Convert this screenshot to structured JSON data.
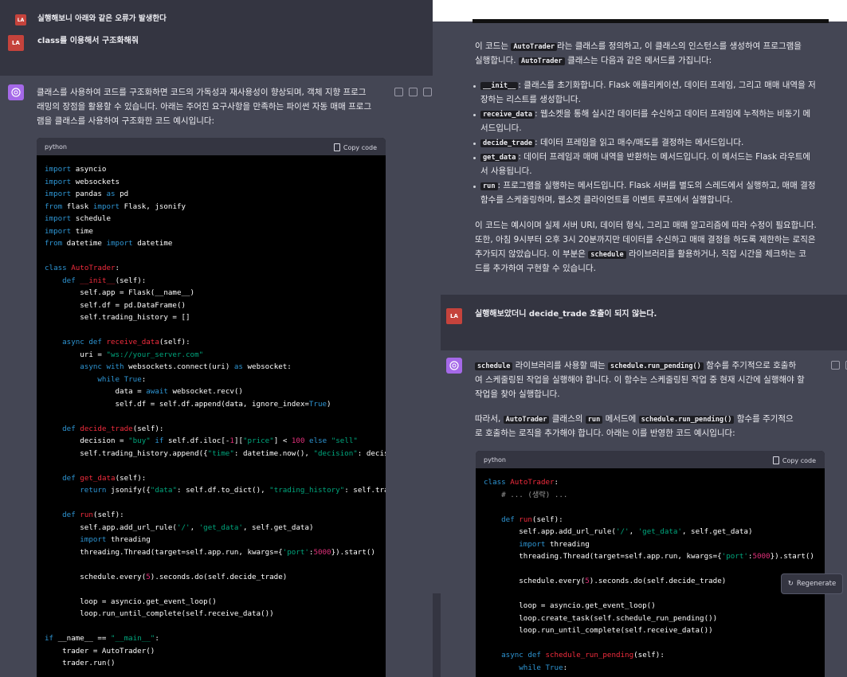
{
  "left": {
    "user_msg_1": "실행해보니 아래와 같은 오류가 발생한다",
    "user_msg_2": "class를 이용해서 구조화해줘",
    "user_avatar": "LA",
    "answer_line_1": "클래스를 사용하여 코드를 구조화하면 코드의 가독성과 재사용성이 향상되며, 객체 지향 프로그",
    "answer_line_2": "래밍의 장점을 활용할 수 있습니다. 아래는 주어진 요구사항을 만족하는 파이썬 자동 매매 프로그",
    "answer_line_3": "램을 클래스를 사용하여 구조화한 코드 예시입니다:",
    "code_lang": "python",
    "copy_label": "Copy code",
    "code": [
      [
        [
          "k",
          "import"
        ],
        [
          "t",
          " asyncio"
        ]
      ],
      [
        [
          "k",
          "import"
        ],
        [
          "t",
          " websockets"
        ]
      ],
      [
        [
          "k",
          "import"
        ],
        [
          "t",
          " pandas "
        ],
        [
          "k",
          "as"
        ],
        [
          "t",
          " pd"
        ]
      ],
      [
        [
          "k",
          "from"
        ],
        [
          "t",
          " flask "
        ],
        [
          "k",
          "import"
        ],
        [
          "t",
          " Flask, jsonify"
        ]
      ],
      [
        [
          "k",
          "import"
        ],
        [
          "t",
          " schedule"
        ]
      ],
      [
        [
          "k",
          "import"
        ],
        [
          "t",
          " time"
        ]
      ],
      [
        [
          "k",
          "from"
        ],
        [
          "t",
          " datetime "
        ],
        [
          "k",
          "import"
        ],
        [
          "t",
          " datetime"
        ]
      ],
      [],
      [
        [
          "k",
          "class"
        ],
        [
          "t",
          " "
        ],
        [
          "c",
          "AutoTrader"
        ],
        [
          "t",
          ":"
        ]
      ],
      [
        [
          "t",
          "    "
        ],
        [
          "k",
          "def"
        ],
        [
          "t",
          " "
        ],
        [
          "c",
          "__init__"
        ],
        [
          "t",
          "(self):"
        ]
      ],
      [
        [
          "t",
          "        self.app = Flask(__name__)"
        ]
      ],
      [
        [
          "t",
          "        self.df = pd.DataFrame()"
        ]
      ],
      [
        [
          "t",
          "        self.trading_history = []"
        ]
      ],
      [],
      [
        [
          "t",
          "    "
        ],
        [
          "k",
          "async def"
        ],
        [
          "t",
          " "
        ],
        [
          "c",
          "receive_data"
        ],
        [
          "t",
          "(self):"
        ]
      ],
      [
        [
          "t",
          "        uri = "
        ],
        [
          "s",
          "\"ws://your_server.com\""
        ]
      ],
      [
        [
          "t",
          "        "
        ],
        [
          "k",
          "async with"
        ],
        [
          "t",
          " websockets.connect(uri) "
        ],
        [
          "k",
          "as"
        ],
        [
          "t",
          " websocket:"
        ]
      ],
      [
        [
          "t",
          "            "
        ],
        [
          "k",
          "while"
        ],
        [
          "t",
          " "
        ],
        [
          "k",
          "True"
        ],
        [
          "t",
          ":"
        ]
      ],
      [
        [
          "t",
          "                data = "
        ],
        [
          "k",
          "await"
        ],
        [
          "t",
          " websocket.recv()"
        ]
      ],
      [
        [
          "t",
          "                self.df = self.df.append(data, ignore_index="
        ],
        [
          "k",
          "True"
        ],
        [
          "t",
          ")"
        ]
      ],
      [],
      [
        [
          "t",
          "    "
        ],
        [
          "k",
          "def"
        ],
        [
          "t",
          " "
        ],
        [
          "c",
          "decide_trade"
        ],
        [
          "t",
          "(self):"
        ]
      ],
      [
        [
          "t",
          "        decision = "
        ],
        [
          "s",
          "\"buy\""
        ],
        [
          "t",
          " "
        ],
        [
          "k",
          "if"
        ],
        [
          "t",
          " self.df.iloc[-"
        ],
        [
          "n",
          "1"
        ],
        [
          "t",
          "]["
        ],
        [
          "s",
          "\"price\""
        ],
        [
          "t",
          "] < "
        ],
        [
          "n",
          "100"
        ],
        [
          "t",
          " "
        ],
        [
          "k",
          "else"
        ],
        [
          "t",
          " "
        ],
        [
          "s",
          "\"sell\""
        ]
      ],
      [
        [
          "t",
          "        self.trading_history.append({"
        ],
        [
          "s",
          "\"time\""
        ],
        [
          "t",
          ": datetime.now(), "
        ],
        [
          "s",
          "\"decision\""
        ],
        [
          "t",
          ": decision})"
        ]
      ],
      [],
      [
        [
          "t",
          "    "
        ],
        [
          "k",
          "def"
        ],
        [
          "t",
          " "
        ],
        [
          "c",
          "get_data"
        ],
        [
          "t",
          "(self):"
        ]
      ],
      [
        [
          "t",
          "        "
        ],
        [
          "k",
          "return"
        ],
        [
          "t",
          " jsonify({"
        ],
        [
          "s",
          "\"data\""
        ],
        [
          "t",
          ": self.df.to_dict(), "
        ],
        [
          "s",
          "\"trading_history\""
        ],
        [
          "t",
          ": self.trading_history})"
        ]
      ],
      [],
      [
        [
          "t",
          "    "
        ],
        [
          "k",
          "def"
        ],
        [
          "t",
          " "
        ],
        [
          "c",
          "run"
        ],
        [
          "t",
          "(self):"
        ]
      ],
      [
        [
          "t",
          "        self.app.add_url_rule("
        ],
        [
          "s",
          "'/'"
        ],
        [
          "t",
          ", "
        ],
        [
          "s",
          "'get_data'"
        ],
        [
          "t",
          ", self.get_data)"
        ]
      ],
      [
        [
          "t",
          "        "
        ],
        [
          "k",
          "import"
        ],
        [
          "t",
          " threading"
        ]
      ],
      [
        [
          "t",
          "        threading.Thread(target=self.app.run, kwargs={"
        ],
        [
          "s",
          "'port'"
        ],
        [
          "t",
          ":"
        ],
        [
          "n",
          "5000"
        ],
        [
          "t",
          "}).start()"
        ]
      ],
      [],
      [
        [
          "t",
          "        schedule.every("
        ],
        [
          "n",
          "5"
        ],
        [
          "t",
          ").seconds.do(self.decide_trade)"
        ]
      ],
      [],
      [
        [
          "t",
          "        loop = asyncio.get_event_loop()"
        ]
      ],
      [
        [
          "t",
          "        loop.run_until_complete(self.receive_data())"
        ]
      ],
      [],
      [
        [
          "k",
          "if"
        ],
        [
          "t",
          " __name__ == "
        ],
        [
          "s",
          "\"__main__\""
        ],
        [
          "t",
          ":"
        ]
      ],
      [
        [
          "t",
          "    trader = AutoTrader()"
        ]
      ],
      [
        [
          "t",
          "    trader.run()"
        ]
      ]
    ]
  },
  "right": {
    "intro_1_pre": "이 코드는 ",
    "intro_1_code": "AutoTrader",
    "intro_1_post": "라는 클래스를 정의하고, 이 클래스의 인스턴스를 생성하여 프로그램을",
    "intro_2_pre": "실행합니다. ",
    "intro_2_code": "AutoTrader",
    "intro_2_post": " 클래스는 다음과 같은 메서드를 가집니다:",
    "b1_code": "__init__",
    "b1_l1": ": 클래스를 초기화합니다. Flask 애플리케이션, 데이터 프레임, 그리고 매매 내역을 저",
    "b1_l2": "장하는 리스트를 생성합니다.",
    "b2_code": "receive_data",
    "b2_l1": ": 웹소켓을 통해 실시간 데이터를 수신하고 데이터 프레임에 누적하는 비동기 메",
    "b2_l2": "서드입니다.",
    "b3_code": "decide_trade",
    "b3_l1": ": 데이터 프레임을 읽고 매수/매도를 결정하는 메서드입니다.",
    "b4_code": "get_data",
    "b4_l1": ": 데이터 프레임과 매매 내역을 반환하는 메서드입니다. 이 메서드는 Flask 라우트에",
    "b4_l2": "서 사용됩니다.",
    "b5_code": "run",
    "b5_l1": ": 프로그램을 실행하는 메서드입니다. Flask 서버를 별도의 스레드에서 실행하고, 매매 결정",
    "b5_l2": "함수를 스케줄링하며, 웹소켓 클라이언트를 이벤트 루프에서 실행합니다.",
    "note_1": "이 코드는 예시이며 실제 서버 URI, 데이터 형식, 그리고 매매 알고리즘에 따라 수정이 필요합니다.",
    "note_2": "또한, 아침 9시부터 오후 3시 20분까지만 데이터를 수신하고 매매 결정을 하도록 제한하는 로직은",
    "note_3_pre": "추가되지 않았습니다. 이 부분은 ",
    "note_3_code": "schedule",
    "note_3_post": " 라이브러리를 활용하거나, 직접 시간을 체크하는 코",
    "note_4": "드를 추가하여 구현할 수 있습니다.",
    "user_avatar": "LA",
    "user_msg": "실행해보았더니 decide_trade 호출이 되지 않는다.",
    "ans_1_code": "schedule",
    "ans_1_mid": " 라이브러리를 사용할 때는 ",
    "ans_1_code2": "schedule.run_pending()",
    "ans_1_post": " 함수를 주기적으로 호출하",
    "ans_2": "여 스케줄링된 작업을 실행해야 합니다. 이 함수는 스케줄링된 작업 중 현재 시간에 실행해야 할",
    "ans_3": "작업을 찾아 실행합니다.",
    "ans_4_pre": "따라서, ",
    "ans_4_code": "AutoTrader",
    "ans_4_mid": " 클래스의 ",
    "ans_4_code2": "run",
    "ans_4_mid2": " 메서드에 ",
    "ans_4_code3": "schedule.run_pending()",
    "ans_4_post": " 함수를 주기적으",
    "ans_5": "로 호출하는 로직을 추가해야 합니다. 아래는 이를 반영한 코드 예시입니다:",
    "code_lang": "python",
    "copy_label": "Copy code",
    "regenerate": "Regenerate",
    "code": [
      [
        [
          "k",
          "class"
        ],
        [
          "t",
          " "
        ],
        [
          "c",
          "AutoTrader"
        ],
        [
          "t",
          ":"
        ]
      ],
      [
        [
          "t",
          "    "
        ],
        [
          "cm",
          "# ... (생략) ..."
        ]
      ],
      [],
      [
        [
          "t",
          "    "
        ],
        [
          "k",
          "def"
        ],
        [
          "t",
          " "
        ],
        [
          "c",
          "run"
        ],
        [
          "t",
          "(self):"
        ]
      ],
      [
        [
          "t",
          "        self.app.add_url_rule("
        ],
        [
          "s",
          "'/'"
        ],
        [
          "t",
          ", "
        ],
        [
          "s",
          "'get_data'"
        ],
        [
          "t",
          ", self.get_data)"
        ]
      ],
      [
        [
          "t",
          "        "
        ],
        [
          "k",
          "import"
        ],
        [
          "t",
          " threading"
        ]
      ],
      [
        [
          "t",
          "        threading.Thread(target=self.app.run, kwargs={"
        ],
        [
          "s",
          "'port'"
        ],
        [
          "t",
          ":"
        ],
        [
          "n",
          "5000"
        ],
        [
          "t",
          "}).start()"
        ]
      ],
      [],
      [
        [
          "t",
          "        schedule.every("
        ],
        [
          "n",
          "5"
        ],
        [
          "t",
          ").seconds.do(self.decide_trade)"
        ]
      ],
      [],
      [
        [
          "t",
          "        loop = asyncio.get_event_loop()"
        ]
      ],
      [
        [
          "t",
          "        loop.create_task(self.schedule_run_pending())"
        ]
      ],
      [
        [
          "t",
          "        loop.run_until_complete(self.receive_data())"
        ]
      ],
      [],
      [
        [
          "t",
          "    "
        ],
        [
          "k",
          "async def"
        ],
        [
          "t",
          " "
        ],
        [
          "c",
          "schedule_run_pending"
        ],
        [
          "t",
          "(self):"
        ]
      ],
      [
        [
          "t",
          "        "
        ],
        [
          "k",
          "while"
        ],
        [
          "t",
          " "
        ],
        [
          "k",
          "True"
        ],
        [
          "t",
          ":"
        ]
      ]
    ]
  }
}
